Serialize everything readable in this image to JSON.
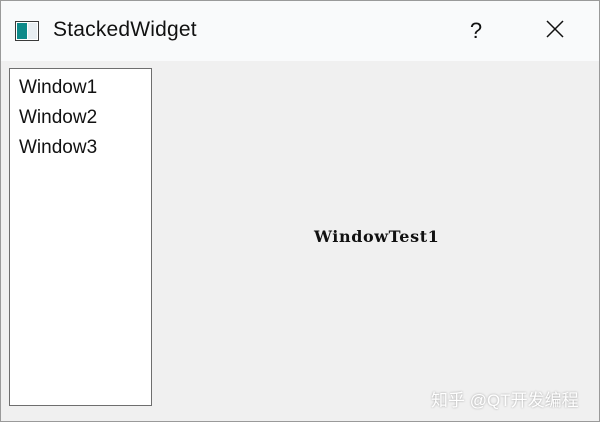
{
  "window": {
    "title": "StackedWidget",
    "help_label": "?",
    "close_icon": "close-icon",
    "app_icon": "app-window-icon"
  },
  "list": {
    "items": [
      {
        "label": "Window1"
      },
      {
        "label": "Window2"
      },
      {
        "label": "Window3"
      }
    ]
  },
  "stack": {
    "current_label": "WindowTest1"
  },
  "watermark": {
    "text": "知乎 @QT开发编程"
  },
  "colors": {
    "titlebar": "#f9fafb",
    "client_area": "#f0f0f0",
    "list_background": "#ffffff",
    "list_border": "#6e6e6e",
    "icon_teal": "#0e8a8a"
  }
}
